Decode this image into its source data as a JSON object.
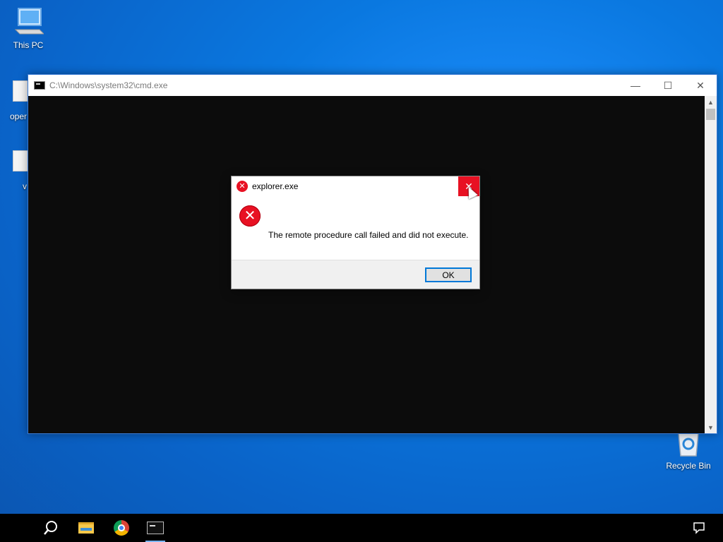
{
  "desktop": {
    "icons": [
      {
        "label": "This PC",
        "icon": "computer-icon"
      },
      {
        "label": "Recycle Bin",
        "icon": "recycle-bin-icon"
      }
    ],
    "partial_labels": [
      "oper",
      "v"
    ]
  },
  "cmd_window": {
    "title": "C:\\Windows\\system32\\cmd.exe",
    "minimize_glyph": "—",
    "maximize_glyph": "☐",
    "close_glyph": "✕",
    "scroll_up_glyph": "▲",
    "scroll_down_glyph": "▼"
  },
  "dialog": {
    "title": "explorer.exe",
    "message": "The remote procedure call failed and did not execute.",
    "ok_label": "OK",
    "close_glyph": "✕",
    "error_glyph": "✕",
    "accent_color": "#e81123"
  },
  "taskbar": {
    "items": [
      "search-icon",
      "file-explorer-icon",
      "chrome-icon",
      "cmd-icon"
    ],
    "notification_icon": "notification-icon"
  }
}
